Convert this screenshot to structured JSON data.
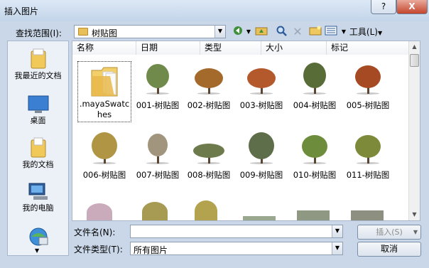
{
  "window": {
    "title": "插入图片",
    "help": "?",
    "close": "X"
  },
  "lookin": {
    "label": "查找范围(I):",
    "value": "树贴图"
  },
  "toolbar": {
    "tools_label": "工具(L)"
  },
  "places": [
    {
      "label": "我最近的文档",
      "icon": "recent-documents-icon"
    },
    {
      "label": "桌面",
      "icon": "desktop-icon"
    },
    {
      "label": "我的文档",
      "icon": "my-documents-icon"
    },
    {
      "label": "我的电脑",
      "icon": "my-computer-icon"
    }
  ],
  "columns": [
    "名称",
    "日期",
    "类型",
    "大小",
    "标记"
  ],
  "files": [
    {
      "name": ".mayaSwatches",
      "kind": "folder"
    },
    {
      "name": "001-树贴图",
      "color": "#6f8a4a"
    },
    {
      "name": "002-树贴图",
      "color": "#a46a2c"
    },
    {
      "name": "003-树贴图",
      "color": "#b4592c"
    },
    {
      "name": "004-树贴图",
      "color": "#586c37"
    },
    {
      "name": "005-树贴图",
      "color": "#a64a23"
    },
    {
      "name": "006-树贴图",
      "color": "#b09544"
    },
    {
      "name": "007-树贴图",
      "color": "#8a7a5e"
    },
    {
      "name": "008-树贴图",
      "color": "#6c7a4c"
    },
    {
      "name": "009-树贴图",
      "color": "#5f6e4a"
    },
    {
      "name": "010-树贴图",
      "color": "#6e8d3c"
    },
    {
      "name": "011-树贴图",
      "color": "#7d8a3a"
    }
  ],
  "filename": {
    "label": "文件名(N):",
    "value": ""
  },
  "filetype": {
    "label": "文件类型(T):",
    "value": "所有图片"
  },
  "buttons": {
    "insert": "插入(S)",
    "cancel": "取消"
  }
}
